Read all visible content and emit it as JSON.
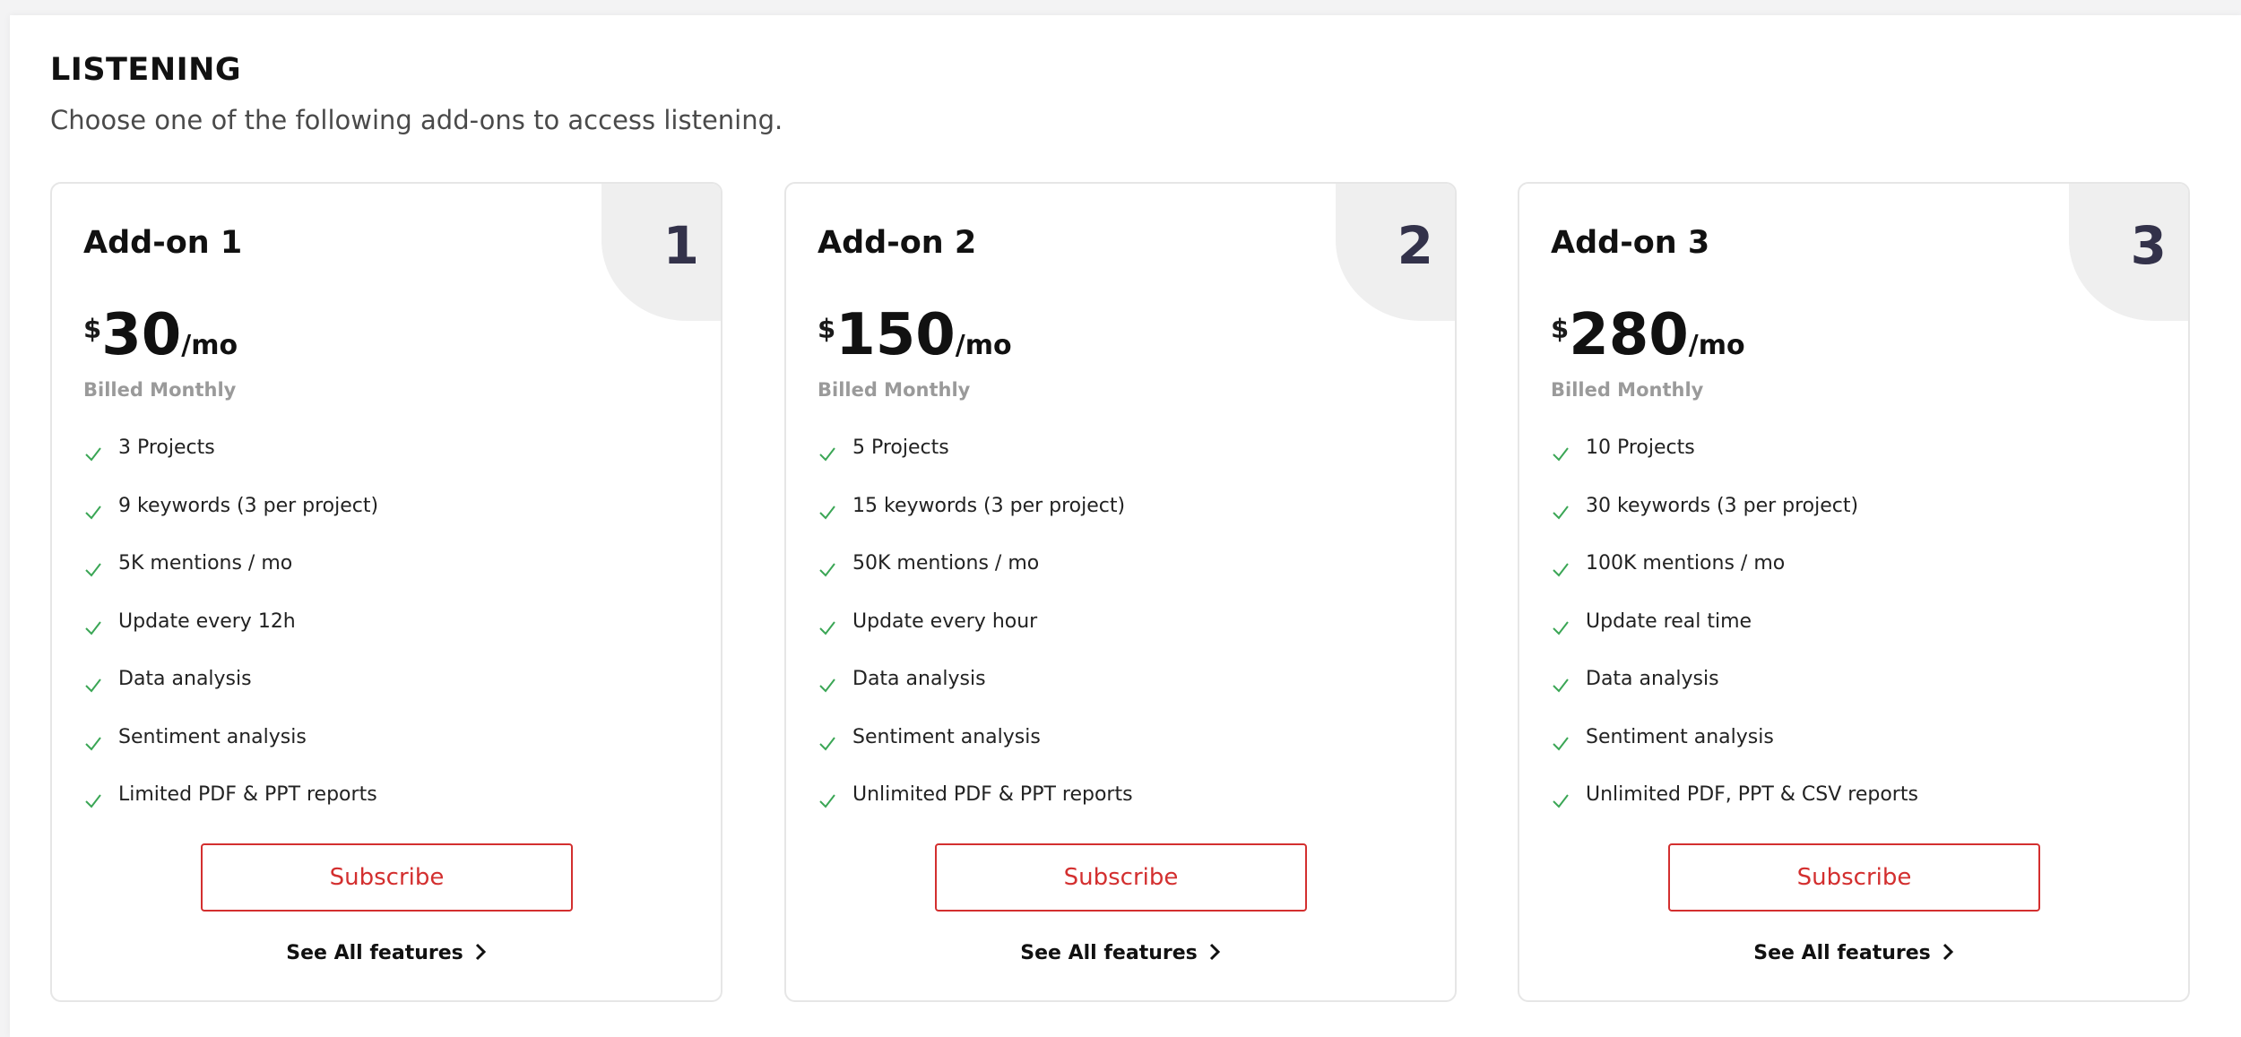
{
  "section": {
    "title": "LISTENING",
    "subtitle": "Choose one of the following add-ons to access listening."
  },
  "icons": {
    "check": "check-icon",
    "chevron": "chevron-right-icon"
  },
  "colors": {
    "accent": "#d32f2f",
    "check": "#3aa655",
    "corner_number": "#33324a"
  },
  "cards": [
    {
      "number": "1",
      "title": "Add-on 1",
      "currency": "$",
      "amount": "30",
      "period": "/mo",
      "billing": "Billed Monthly",
      "features": [
        "3 Projects",
        "9 keywords (3 per project)",
        "5K mentions / mo",
        "Update every 12h",
        "Data analysis",
        "Sentiment analysis",
        "Limited PDF & PPT reports"
      ],
      "subscribe_label": "Subscribe",
      "see_all_label": "See All features"
    },
    {
      "number": "2",
      "title": "Add-on 2",
      "currency": "$",
      "amount": "150",
      "period": "/mo",
      "billing": "Billed Monthly",
      "features": [
        "5 Projects",
        "15 keywords (3 per project)",
        "50K mentions / mo",
        "Update every hour",
        "Data analysis",
        "Sentiment analysis",
        "Unlimited PDF & PPT reports"
      ],
      "subscribe_label": "Subscribe",
      "see_all_label": "See All features"
    },
    {
      "number": "3",
      "title": "Add-on 3",
      "currency": "$",
      "amount": "280",
      "period": "/mo",
      "billing": "Billed Monthly",
      "features": [
        "10 Projects",
        "30 keywords (3 per project)",
        "100K mentions / mo",
        "Update real time",
        "Data analysis",
        "Sentiment analysis",
        "Unlimited PDF, PPT & CSV reports"
      ],
      "subscribe_label": "Subscribe",
      "see_all_label": "See All features"
    }
  ]
}
